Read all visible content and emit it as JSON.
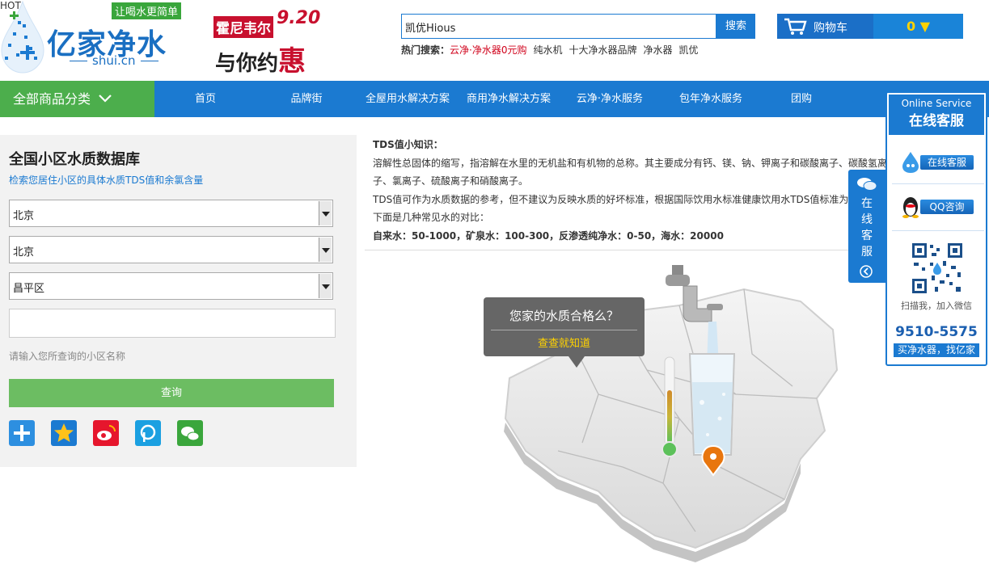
{
  "header": {
    "logo_tagline": "让喝水更简单",
    "logo_brand": "亿家净水",
    "logo_domain": "shui.cn",
    "promo_brand": "霍尼韦尔",
    "promo_date": "9.20",
    "promo_slogan": "与你约",
    "promo_hui": "惠",
    "search_value": "凯优Hious",
    "search_button": "搜索",
    "hot_label": "热门搜索：",
    "hot_items": [
      "云净·净水器0元购",
      "纯水机",
      "十大净水器品牌",
      "净水器",
      "凯优"
    ],
    "cart_label": "购物车",
    "cart_count": "0 ▼"
  },
  "nav": {
    "all_categories": "全部商品分类",
    "items": [
      "首页",
      "品牌街",
      "全屋用水解决方案",
      "商用净水解决方案",
      "云净·净水服务",
      "包年净水服务",
      "团购"
    ],
    "hot_badge": "HOT"
  },
  "left": {
    "title": "全国小区水质数据库",
    "subtitle": "检索您居住小区的具体水质TDS值和余氯含量",
    "province": "北京",
    "city": "北京",
    "district": "昌平区",
    "community_value": "",
    "hint": "请输入您所查询的小区名称",
    "query_button": "查询"
  },
  "knowledge": {
    "title": "TDS值小知识：",
    "p1": "溶解性总固体的缩写，指溶解在水里的无机盐和有机物的总称。其主要成分有钙、镁、钠、钾离子和碳酸离子、碳酸氢离子、氯离子、硫酸离子和硝酸离子。",
    "p2": "TDS值可作为水质数据的参考，但不建议为反映水质的好坏标准，根据国际饮用水标准健康饮用水TDS值标准为50以下，下面是几种常见水的对比：",
    "compare": "自来水：50-1000，矿泉水：100-300，反渗透纯净水：0-50，海水：20000"
  },
  "bubble": {
    "question": "您家的水质合格么？",
    "link": "查查就知道"
  },
  "float_tab": {
    "text": "在线客服"
  },
  "service": {
    "en_title": "Online Service",
    "cn_title": "在线客服",
    "online_label": "在线客服",
    "qq_label": "QQ咨询",
    "scan_text": "扫描我，加入微信",
    "phone": "9510-5575",
    "buy_text": "买净水器，找亿家"
  },
  "colors": {
    "primary_blue": "#1b7ad1",
    "green": "#4cae4c",
    "button_green": "#6cbd62",
    "red": "#c8102e"
  }
}
